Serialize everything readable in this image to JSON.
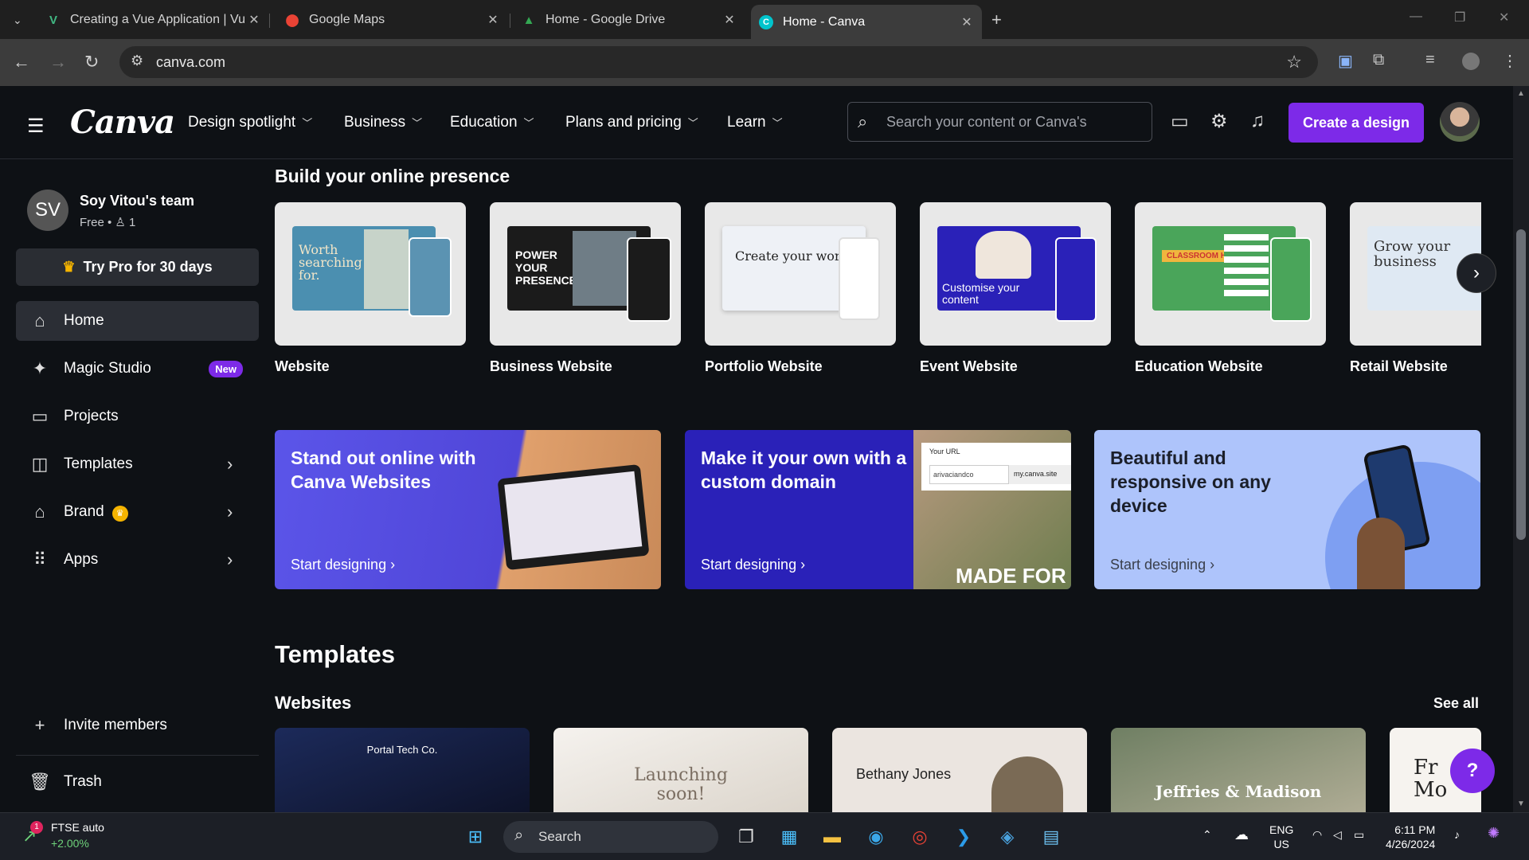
{
  "browser": {
    "tabs": [
      {
        "title": "Creating a Vue Application | Vu",
        "icon": "vue-icon"
      },
      {
        "title": "Google Maps",
        "icon": "maps-pin-icon"
      },
      {
        "title": "Home - Google Drive",
        "icon": "drive-icon"
      },
      {
        "title": "Home - Canva",
        "icon": "canva-icon",
        "active": true
      }
    ],
    "url": "canva.com"
  },
  "header": {
    "logo": "Canva",
    "menu": [
      "Design spotlight",
      "Business",
      "Education",
      "Plans and pricing",
      "Learn"
    ],
    "search_placeholder": "Search your content or Canva's",
    "create_label": "Create a design"
  },
  "sidebar": {
    "team_initials": "SV",
    "team_name": "Soy Vitou's team",
    "team_plan": "Free • ♙ 1",
    "try_pro": "Try Pro for 30 days",
    "items": [
      {
        "label": "Home",
        "icon": "home-icon"
      },
      {
        "label": "Magic Studio",
        "icon": "sparkle-icon",
        "badge": "New"
      },
      {
        "label": "Projects",
        "icon": "folder-icon"
      },
      {
        "label": "Templates",
        "icon": "templates-icon"
      },
      {
        "label": "Brand",
        "icon": "brand-icon"
      },
      {
        "label": "Apps",
        "icon": "apps-grid-icon"
      }
    ],
    "invite": "Invite members",
    "trash": "Trash"
  },
  "main": {
    "online_heading": "Build your online presence",
    "cards": [
      {
        "label": "Website",
        "thumb_text": "Worth searching for."
      },
      {
        "label": "Business Website",
        "thumb_text": "POWER YOUR PRESENCE"
      },
      {
        "label": "Portfolio Website",
        "thumb_text": "Create your world"
      },
      {
        "label": "Event Website",
        "thumb_text": "Customise your content"
      },
      {
        "label": "Education Website",
        "thumb_text": "CLASSROOM HUB"
      },
      {
        "label": "Retail Website",
        "thumb_text": "Grow your business"
      }
    ],
    "promos": [
      {
        "title": "Stand out online with Canva Websites",
        "link": "Start designing"
      },
      {
        "title": "Make it your own with a custom domain",
        "link": "Start designing",
        "url_label": "Your URL",
        "url_value": "arivaciandco",
        "url_domain": "my.canva.site",
        "image_text": "MADE FOR"
      },
      {
        "title": "Beautiful and responsive on any device",
        "link": "Start designing"
      }
    ],
    "templates_heading": "Templates",
    "websites_heading": "Websites",
    "see_all": "See all",
    "template_cards": [
      "Portal Tech Co.",
      "Launching soon!",
      "Bethany Jones",
      "Jeffries & Madison",
      "Fr Mo"
    ],
    "help": "?"
  },
  "taskbar": {
    "stock_name": "FTSE auto",
    "stock_change": "+2.00%",
    "stock_badge": "1",
    "search": "Search",
    "lang": "ENG",
    "region": "US",
    "time": "6:11 PM",
    "date": "4/26/2024"
  },
  "colors": {
    "accent": "#7d2ae8",
    "crown": "#f5b400",
    "background": "#0e1115"
  }
}
